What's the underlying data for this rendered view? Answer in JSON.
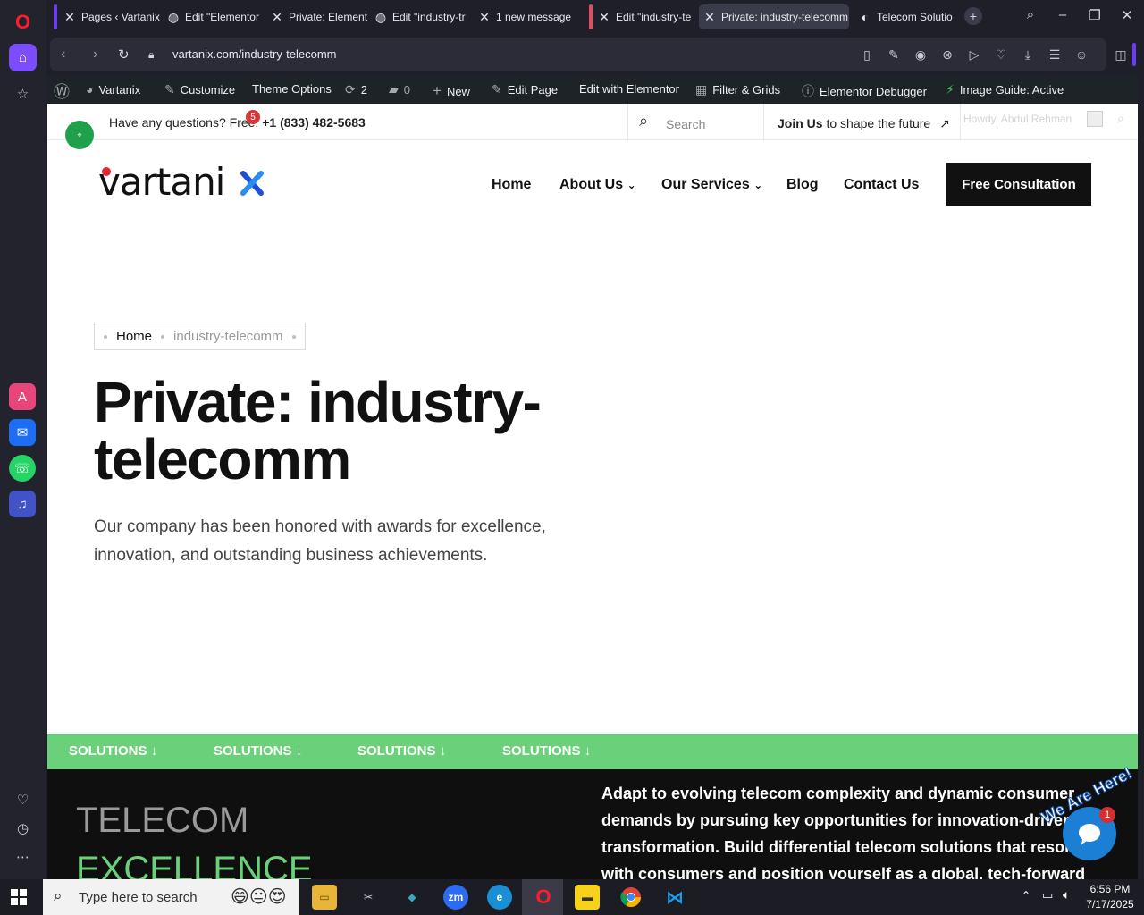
{
  "browser": {
    "tabs": [
      {
        "label": "Pages ‹ Vartanix",
        "icon": "x-icon"
      },
      {
        "label": "Edit \"Elementor",
        "icon": "globe-icon"
      },
      {
        "label": "Private: Element",
        "icon": "x-icon"
      },
      {
        "label": "Edit \"industry-tr",
        "icon": "globe-icon"
      },
      {
        "label": "1 new message",
        "icon": "x-icon"
      },
      {
        "label": "Edit \"industry-te",
        "icon": "x-icon"
      },
      {
        "label": "Private: industry-telecomm",
        "icon": "x-icon",
        "active": true
      },
      {
        "label": "Telecom Solutio",
        "icon": "c-icon"
      }
    ],
    "url": "vartanix.com/industry-telecomm"
  },
  "wp_admin": {
    "site": "Vartanix",
    "customize": "Customize",
    "theme_options": "Theme Options",
    "updates": "2",
    "comments": "0",
    "new": "New",
    "edit_page": "Edit Page",
    "edit_elementor": "Edit with Elementor",
    "filter_grids": "Filter & Grids",
    "debugger": "Elementor Debugger",
    "image_guide": "Image Guide: Active",
    "howdy": "Howdy, Abdul Rehman"
  },
  "site": {
    "top_question": "Have any questions? Free:",
    "phone": "+1 (833) 482-5683",
    "notification_count": "5",
    "search_placeholder": "Search",
    "join_bold": "Join Us",
    "join_rest": "to shape the future",
    "logo": "vartanix",
    "nav": [
      "Home",
      "About Us",
      "Our Services",
      "Blog",
      "Contact Us"
    ],
    "cta": "Free Consultation",
    "breadcrumb_home": "Home",
    "breadcrumb_current": "industry-telecomm",
    "title": "Private: industry-telecomm",
    "subtitle": "Our company has been honored with awards for excellence, innovation, and outstanding business achievements.",
    "solutions": [
      "SOLUTIONS",
      "SOLUTIONS",
      "SOLUTIONS",
      "SOLUTIONS"
    ],
    "section_title_1": "TELECOM",
    "section_title_2": "EXCELLENCE",
    "section_para": "Adapt to evolving telecom complexity and dynamic consumer demands by pursuing key opportunities for innovation-driven transformation. Build differential telecom solutions that resonate with consumers and position yourself as a global, tech-forward telecom",
    "chat_badge": "1",
    "chat_banner": "We Are Here!"
  },
  "taskbar": {
    "search_placeholder": "Type here to search",
    "time": "6:56 PM",
    "date": "7/17/2025"
  },
  "colors": {
    "accent_green": "#6ad17a",
    "opera_purple": "#7c4dff",
    "cta_black": "#111111",
    "chat_blue": "#1b7fd6"
  }
}
